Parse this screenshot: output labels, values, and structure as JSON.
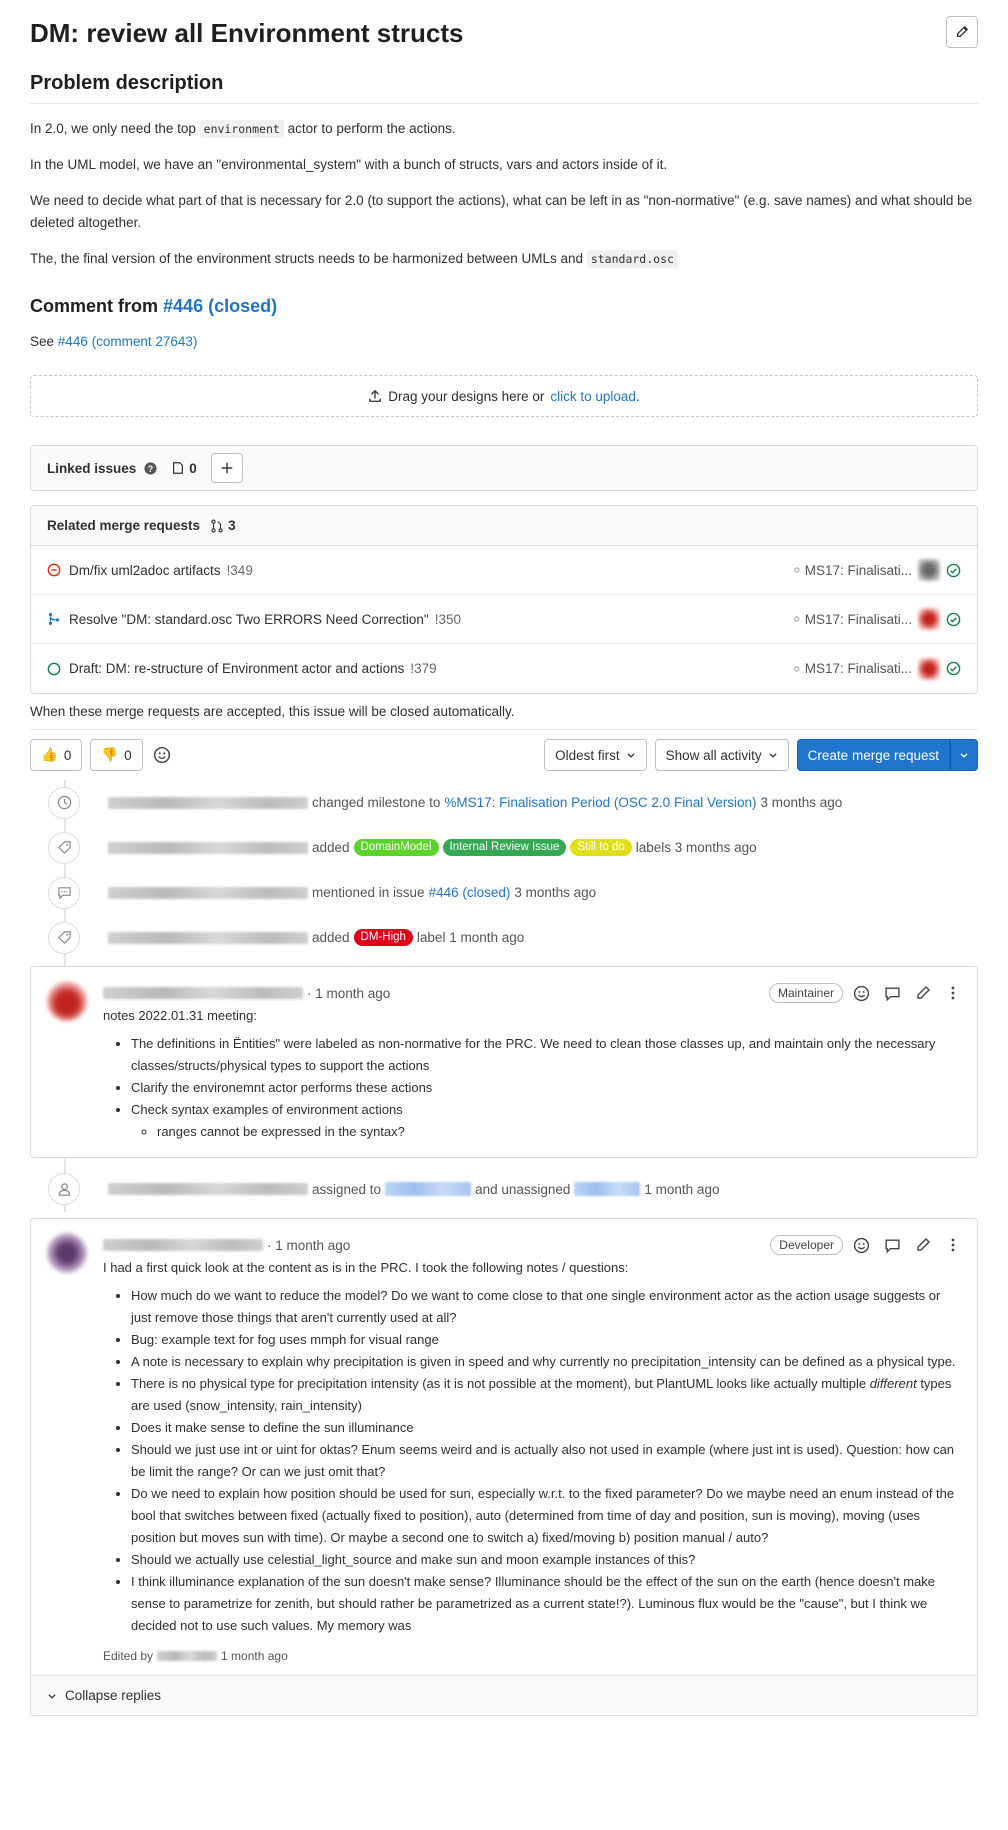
{
  "issue": {
    "title": "DM: review all Environment structs",
    "edit_icon": "pencil-icon"
  },
  "description": {
    "heading": "Problem description",
    "p1_before": "In 2.0, we only need the top",
    "p1_code": "environment",
    "p1_after": "actor to perform the actions.",
    "p2": "In the UML model, we have an \"environmental_system\" with a bunch of structs, vars and actors inside of it.",
    "p3": "We need to decide what part of that is necessary for 2.0 (to support the actions), what can be left in as \"non-normative\" (e.g. save names) and what should be deleted altogether.",
    "p4_before": "The, the final version of the environment structs needs to be harmonized between UMLs and",
    "p4_code": "standard.osc",
    "comment_heading_prefix": "Comment from",
    "comment_heading_link": "#446 (closed)",
    "see_prefix": "See",
    "see_link": "#446 (comment 27643)"
  },
  "dropzone": {
    "text": "Drag your designs here or",
    "link": "click to upload",
    "suffix": "."
  },
  "linked_issues": {
    "label": "Linked issues",
    "count": "0"
  },
  "related_mrs": {
    "label": "Related merge requests",
    "count": "3",
    "items": [
      {
        "status": "closed",
        "title": "Dm/fix uml2adoc artifacts",
        "ref": "!349",
        "milestone": "MS17: Finalisati..."
      },
      {
        "status": "merged",
        "title": "Resolve \"DM: standard.osc Two ERRORS Need Correction\"",
        "ref": "!350",
        "milestone": "MS17: Finalisati..."
      },
      {
        "status": "open",
        "title": "Draft: DM: re-structure of Environment actor and actions",
        "ref": "!379",
        "milestone": "MS17: Finalisati..."
      }
    ],
    "close_note": "When these merge requests are accepted, this issue will be closed automatically."
  },
  "actions": {
    "thumbs_up": "0",
    "thumbs_down": "0",
    "sort": "Oldest first",
    "filter": "Show all activity",
    "create_mr": "Create merge request"
  },
  "activity": {
    "milestone": {
      "text": "changed milestone to",
      "link": "%MS17: Finalisation Period (OSC 2.0 Final Version)",
      "time": "3 months ago"
    },
    "labels": {
      "added": "added",
      "labels": [
        {
          "name": "DomainModel",
          "color": "#5bd32b",
          "text_color": "#ffffff"
        },
        {
          "name": "Internal Review Issue",
          "color": "#34a853",
          "text_color": "#ffffff"
        },
        {
          "name": "Still to do",
          "color": "#e0e01a",
          "text_color": "#ffffff"
        }
      ],
      "suffix": "labels 3 months ago"
    },
    "mention": {
      "text": "mentioned in issue",
      "link": "#446 (closed)",
      "time": "3 months ago"
    },
    "dm_high": {
      "added": "added",
      "label": "DM-High",
      "color": "#e0001a",
      "suffix": "label 1 month ago"
    },
    "assign": {
      "text1": "assigned to",
      "text2": "and unassigned",
      "time": "1 month ago"
    }
  },
  "note1": {
    "time": "· 1 month ago",
    "role": "Maintainer",
    "intro": "notes 2022.01.31 meeting:",
    "items": [
      "The definitions in Ëntities\" were labeled as non-normative for the PRC. We need to clean those classes up, and maintain only the necessary classes/structs/physical types to support the actions",
      "Clarify the environemnt actor performs these actions",
      "Check syntax examples of environment actions"
    ],
    "subitem": "ranges cannot be expressed in the syntax?"
  },
  "note2": {
    "time": "· 1 month ago",
    "role": "Developer",
    "intro": "I had a first quick look at the content as is in the PRC. I took the following notes / questions:",
    "items": [
      "How much do we want to reduce the model? Do we want to come close to that one single environment actor as the action usage suggests or just remove those things that aren't currently used at all?",
      "Bug: example text for fog uses mmph for visual range",
      "A note is necessary to explain why precipitation is given in speed and why currently no precipitation_intensity can be defined as a physical type."
    ],
    "item4_before": "There is no physical type for precipitation intensity (as it is not possible at the moment), but PlantUML looks like actually multiple",
    "item4_em": "different",
    "item4_after": "types are used (snow_intensity, rain_intensity)",
    "items_b": [
      "Does it make sense to define the sun illuminance",
      "Should we just use int or uint for oktas? Enum seems weird and is actually also not used in example (where just int is used). Question: how can be limit the range? Or can we just omit that?",
      "Do we need to explain how position should be used for sun, especially w.r.t. to the fixed parameter? Do we maybe need an enum instead of the bool that switches between fixed (actually fixed to position), auto (determined from time of day and position, sun is moving), moving (uses position but moves sun with time). Or maybe a second one to switch a) fixed/moving b) position manual / auto?",
      "Should we actually use celestial_light_source and make sun and moon example instances of this?",
      "I think illuminance explanation of the sun doesn't make sense? Illuminance should be the effect of the sun on the earth (hence doesn't make sense to parametrize for zenith, but should rather be parametrized as a current state!?). Luminous flux would be the \"cause\", but I think we decided not to use such values. My memory was"
    ],
    "edited_prefix": "Edited by",
    "edited_time": "1 month ago",
    "collapse": "Collapse replies"
  },
  "colors": {
    "link": "#1f75cb",
    "primary": "#1f75cb",
    "closed": "#dd2b0e",
    "merged": "#1f75cb",
    "open": "#108548"
  }
}
